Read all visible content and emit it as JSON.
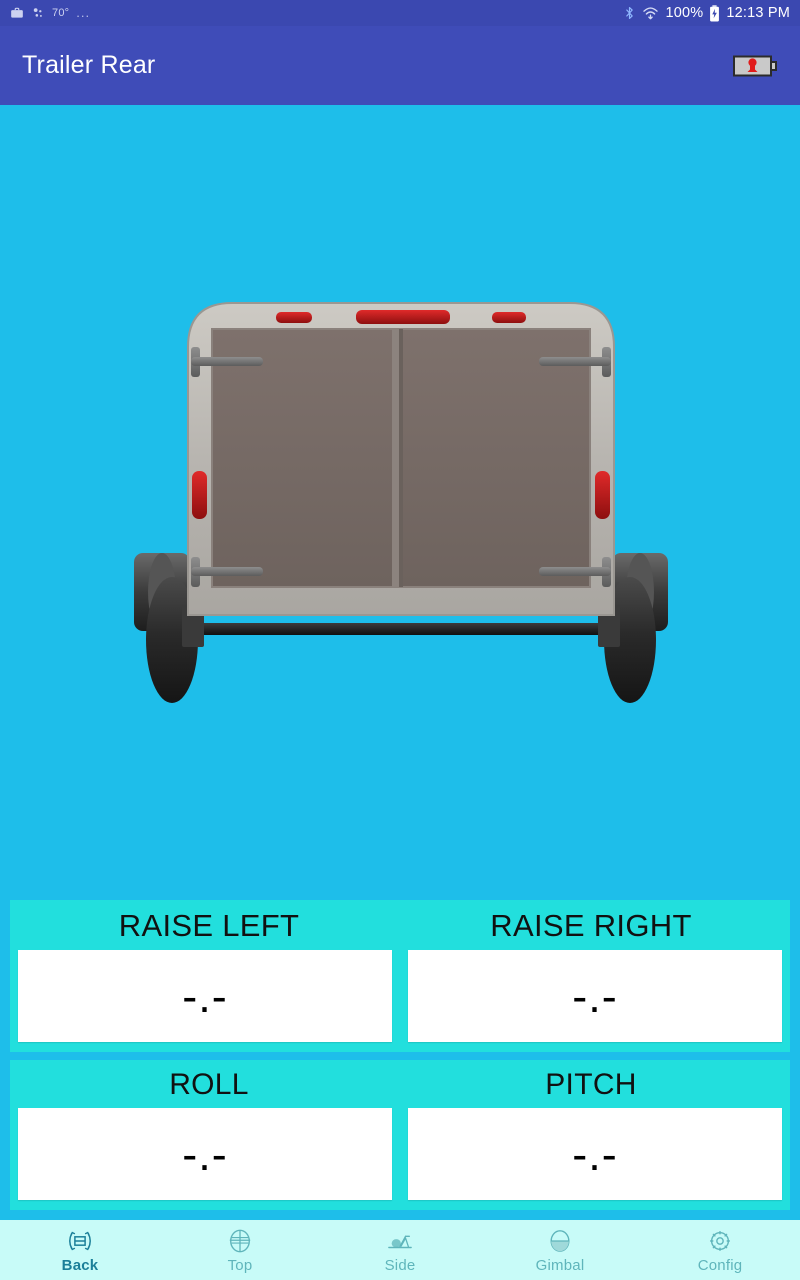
{
  "statusbar": {
    "work_icon": "briefcase-icon",
    "weather_icon": "weather-dots-icon",
    "temperature": "70°",
    "overflow": "...",
    "bluetooth_icon": "bluetooth-icon",
    "wifi_icon": "wifi-icon",
    "battery_percent": "100%",
    "battery_icon": "battery-charging-icon",
    "time": "12:13 PM"
  },
  "appbar": {
    "title": "Trailer Rear",
    "action_icon": "trailer-battery-icon",
    "background": "#3f4cb8"
  },
  "stage": {
    "background": "#1ebeea",
    "illustration": "trailer-rear-view"
  },
  "readouts": {
    "panel_background": "#22dfdd",
    "groups": [
      {
        "labels": [
          "RAISE LEFT",
          "RAISE RIGHT"
        ],
        "values": [
          "-.-",
          "-.-"
        ]
      },
      {
        "labels": [
          "ROLL",
          "PITCH"
        ],
        "values": [
          "-.-",
          "-.-"
        ]
      }
    ]
  },
  "bottomnav": {
    "background": "#c8fbf8",
    "active_color": "#1b7f99",
    "inactive_color": "#5fb5bb",
    "items": [
      {
        "label": "Back",
        "icon": "trailer-back-width-icon",
        "active": true
      },
      {
        "label": "Top",
        "icon": "trailer-top-view-icon",
        "active": false
      },
      {
        "label": "Side",
        "icon": "trailer-side-view-icon",
        "active": false
      },
      {
        "label": "Gimbal",
        "icon": "gimbal-level-icon",
        "active": false
      },
      {
        "label": "Config",
        "icon": "gear-icon",
        "active": false
      }
    ]
  }
}
